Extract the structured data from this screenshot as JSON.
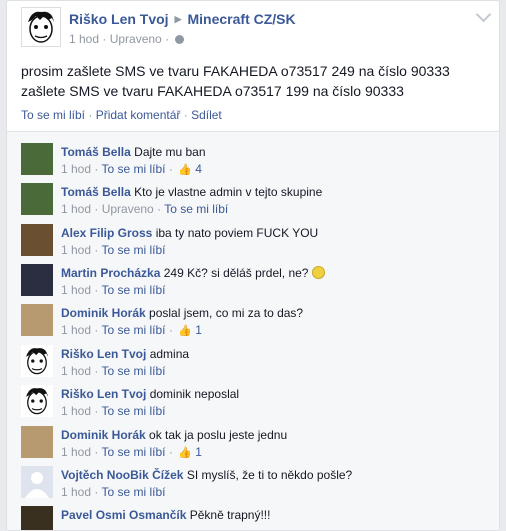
{
  "post": {
    "author": "Riško Len Tvoj",
    "group": "Minecraft CZ/SK",
    "time": "1 hod",
    "edited": "Upraveno",
    "lines": [
      "prosim zašlete SMS ve tvaru FAKAHEDA o73517 249 na číslo 90333",
      "zašlete SMS ve tvaru FAKAHEDA o73517 199 na číslo 90333"
    ],
    "actions": {
      "like": "To se mi líbí",
      "comment": "Přidat komentář",
      "share": "Sdílet"
    }
  },
  "comments": [
    {
      "name": "Tomáš Bella",
      "text": "Dajte mu ban",
      "time": "1 hod",
      "edited": "",
      "like": "To se mi líbí",
      "likes": "4",
      "avatar": "#4a6a3a"
    },
    {
      "name": "Tomáš Bella",
      "text": "Kto je vlastne admin v tejto skupine",
      "time": "1 hod",
      "edited": "Upraveno",
      "like": "To se mi líbí",
      "likes": "",
      "avatar": "#4a6a3a"
    },
    {
      "name": "Alex Filip Gross",
      "text": "iba ty nato poviem FUCK YOU",
      "time": "1 hod",
      "edited": "",
      "like": "To se mi líbí",
      "likes": "",
      "avatar": "#6a5030"
    },
    {
      "name": "Martin Procházka",
      "text": "249 Kč? si děláš prdel, ne?",
      "time": "1 hod",
      "edited": "",
      "like": "To se mi líbí",
      "likes": "",
      "avatar": "#2a2e40"
    },
    {
      "name": "Dominik Horák",
      "text": "poslal jsem, co mi za to das?",
      "time": "1 hod",
      "edited": "",
      "like": "To se mi líbí",
      "likes": "1",
      "avatar": "#b89a70"
    },
    {
      "name": "Riško Len Tvoj",
      "text": "admina",
      "time": "1 hod",
      "edited": "",
      "like": "To se mi líbí",
      "likes": "",
      "avatar": "#ffffff"
    },
    {
      "name": "Riško Len Tvoj",
      "text": "dominik neposlal",
      "time": "1 hod",
      "edited": "",
      "like": "To se mi líbí",
      "likes": "",
      "avatar": "#ffffff"
    },
    {
      "name": "Dominik Horák",
      "text": "ok tak ja poslu jeste jednu",
      "time": "1 hod",
      "edited": "",
      "like": "To se mi líbí",
      "likes": "1",
      "avatar": "#b89a70"
    },
    {
      "name": "Vojtěch NooBik Čížek",
      "text": "SI myslíš, že ti to někdo pošle?",
      "time": "1 hod",
      "edited": "",
      "like": "To se mi líbí",
      "likes": "",
      "avatar": "#c8ccd4"
    },
    {
      "name": "Pavel Osmi Osmančík",
      "text": "Pěkně trapný!!!",
      "time": "",
      "edited": "",
      "like": "",
      "likes": "",
      "avatar": "#3a3020"
    }
  ]
}
